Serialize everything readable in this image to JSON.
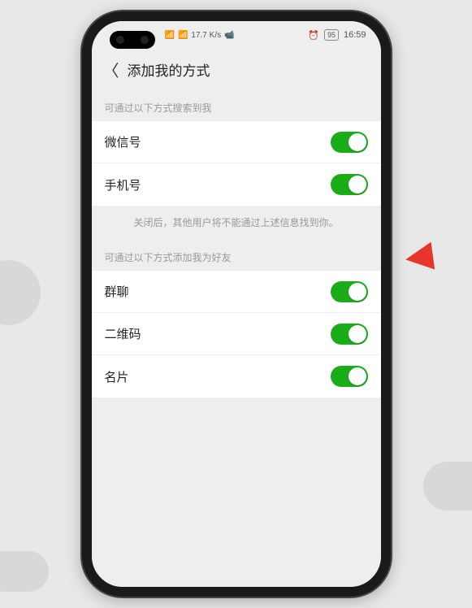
{
  "status": {
    "speed": "17.7 K/s",
    "battery": "95",
    "time": "16:59"
  },
  "header": {
    "title": "添加我的方式"
  },
  "sections": {
    "search": {
      "title": "可通过以下方式搜索到我",
      "items": [
        {
          "label": "微信号",
          "on": true
        },
        {
          "label": "手机号",
          "on": true
        }
      ],
      "hint": "关闭后，其他用户将不能通过上述信息找到你。"
    },
    "add": {
      "title": "可通过以下方式添加我为好友",
      "items": [
        {
          "label": "群聊",
          "on": true
        },
        {
          "label": "二维码",
          "on": true
        },
        {
          "label": "名片",
          "on": true
        }
      ]
    }
  }
}
